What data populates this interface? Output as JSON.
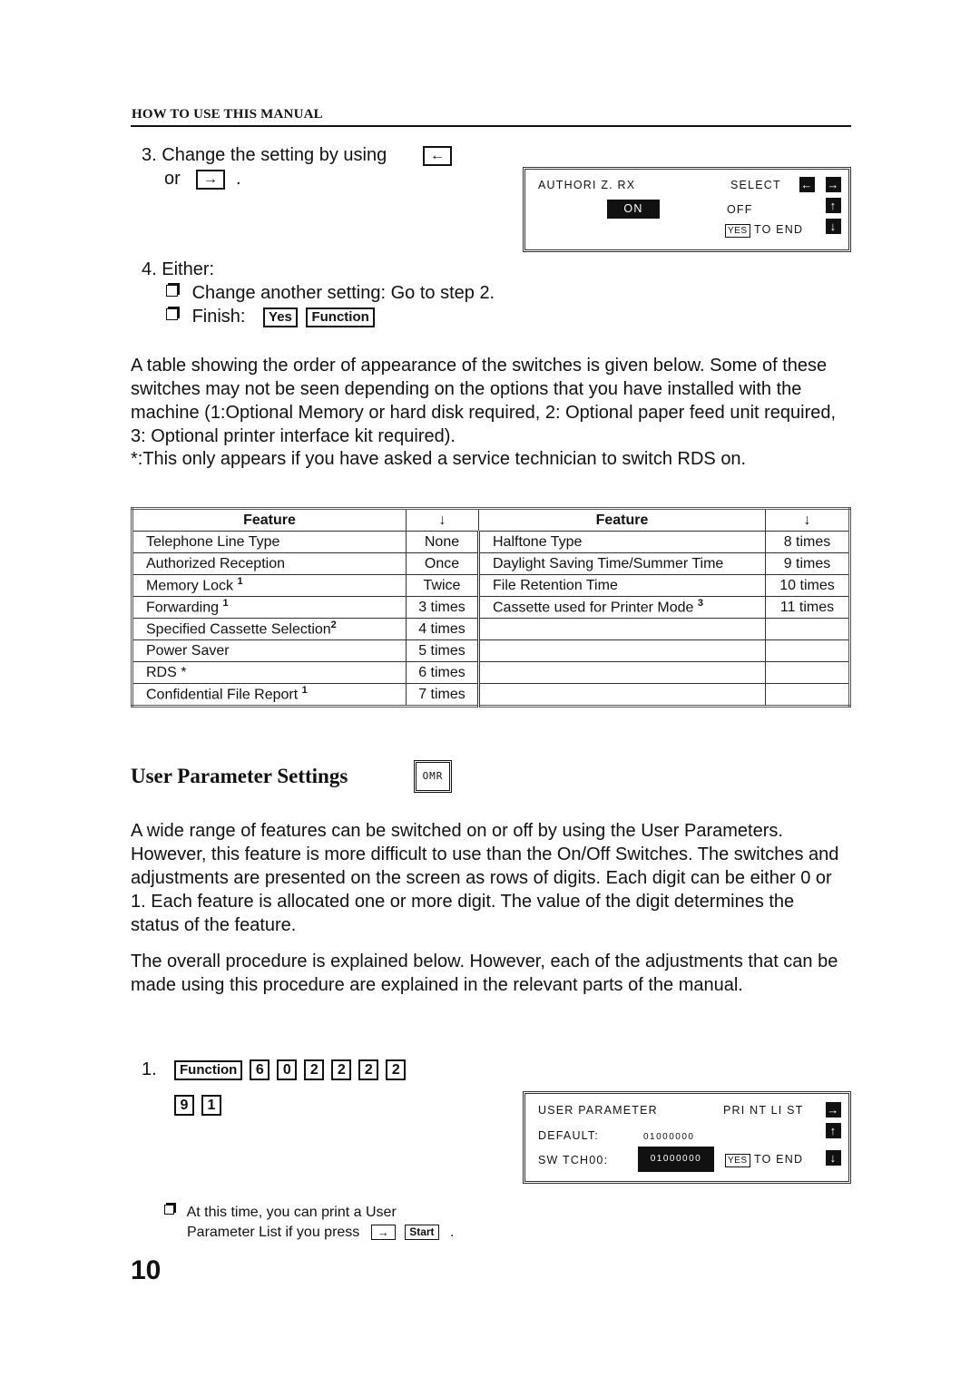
{
  "header": {
    "title": "HOW TO USE THIS MANUAL"
  },
  "step3": {
    "number": "3.",
    "text": "Change the setting by using",
    "or": "or",
    "period": ".",
    "key_left": "←",
    "key_right": "→"
  },
  "lcd1": {
    "label": "AUTHORI Z. RX",
    "select": "SELECT",
    "on": "ON",
    "off": "OFF",
    "yes": "YES",
    "to_end": "TO END",
    "icons": {
      "left": "←",
      "right": "→",
      "up": "↑",
      "down": "↓"
    }
  },
  "step4": {
    "number": "4.",
    "text": "Either:",
    "options": [
      {
        "text": "Change another setting: Go to step 2."
      },
      {
        "text": "Finish:",
        "keys": [
          "Yes",
          "Function"
        ]
      }
    ]
  },
  "paragraph1": "A table showing the order of appearance of the switches is given below. Some of these switches may not be seen depending on the options that you have installed with the machine (1:Optional Memory or hard disk required, 2: Optional paper feed unit required, 3: Optional printer interface kit required).",
  "footnote_rds": "*:This only appears if you have asked a service technician to switch RDS on.",
  "table": {
    "headers": {
      "feature": "Feature",
      "count": "↓"
    },
    "rows": [
      {
        "left": {
          "feature": "Telephone Line Type",
          "sup": "",
          "count": "None"
        },
        "right": {
          "feature": "Halftone Type",
          "sup": "",
          "count": "8 times"
        }
      },
      {
        "left": {
          "feature": "Authorized Reception",
          "sup": "",
          "count": "Once"
        },
        "right": {
          "feature": "Daylight Saving Time/Summer Time",
          "sup": "",
          "count": "9 times"
        }
      },
      {
        "left": {
          "feature": "Memory Lock ",
          "sup": "1",
          "count": "Twice"
        },
        "right": {
          "feature": "File Retention Time",
          "sup": "",
          "count": "10 times"
        }
      },
      {
        "left": {
          "feature": "Forwarding ",
          "sup": "1",
          "count": "3 times"
        },
        "right": {
          "feature": "Cassette used for Printer Mode ",
          "sup": "3",
          "count": "11 times"
        }
      },
      {
        "left": {
          "feature": "Specified Cassette Selection",
          "sup": "2",
          "count": "4 times"
        },
        "right": {
          "feature": "",
          "sup": "",
          "count": ""
        }
      },
      {
        "left": {
          "feature": "Power Saver",
          "sup": "",
          "count": "5 times"
        },
        "right": {
          "feature": "",
          "sup": "",
          "count": ""
        }
      },
      {
        "left": {
          "feature": "RDS *",
          "sup": "",
          "count": "6 times"
        },
        "right": {
          "feature": "",
          "sup": "",
          "count": ""
        }
      },
      {
        "left": {
          "feature": "Confidential File Report ",
          "sup": "1",
          "count": "7 times"
        },
        "right": {
          "feature": "",
          "sup": "",
          "count": ""
        }
      }
    ]
  },
  "section": {
    "title": "User Parameter Settings",
    "badge": "OMR"
  },
  "paragraph2": "A wide range of features can be switched on or off by using the User Parameters. However, this feature is more difficult to use than the On/Off Switches. The switches and adjustments are presented on the screen as rows of digits. Each digit can be either 0 or 1. Each feature is allocated one or more digit. The value of the digit determines the status of the feature.",
  "paragraph3": "The overall procedure is explained below. However, each of the adjustments that can be made using this procedure are explained in the relevant parts of the manual.",
  "step1": {
    "number": "1.",
    "keys_row1": [
      "Function",
      "6",
      "0",
      "2",
      "2",
      "2",
      "2"
    ],
    "keys_row2": [
      "9",
      "1"
    ]
  },
  "lcd2": {
    "label": "USER PARAMETER",
    "print_list": "PRI NT LI ST",
    "default_label": "DEFAULT:",
    "default_value": "01000000",
    "switch_label": "SW TCH00:",
    "switch_value": "01000000",
    "yes": "YES",
    "to_end": "TO END",
    "icons": {
      "right": "→",
      "up": "↑",
      "down": "↓"
    }
  },
  "note": {
    "line1": "At this time, you can print a User",
    "line2": "Parameter List if you press",
    "key_arrow": "→",
    "key_start": "Start",
    "period": "."
  },
  "page_number": "10"
}
